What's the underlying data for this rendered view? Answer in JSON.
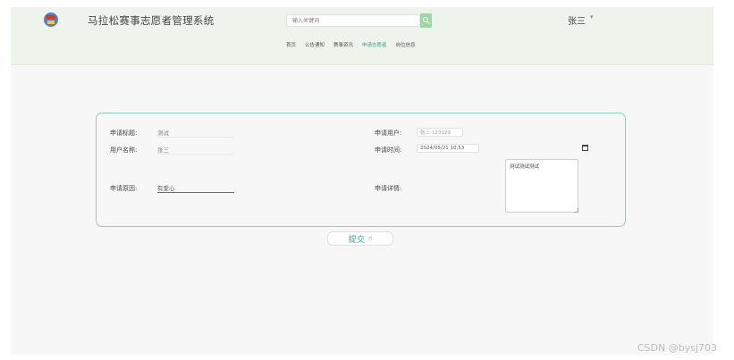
{
  "header": {
    "site_title": "马拉松赛事志愿者管理系统",
    "search_placeholder": "输入关键词",
    "user_name": "张三",
    "user_caret": "▾"
  },
  "nav": {
    "items": [
      {
        "label": "首页"
      },
      {
        "label": "公告通知"
      },
      {
        "label": "赛事资讯"
      },
      {
        "label": "申请志愿者",
        "active": true
      },
      {
        "label": "岗位信息"
      }
    ]
  },
  "form": {
    "title_label": "申请标题:",
    "title_value": "测试",
    "username_label": "用户名称:",
    "username_value": "张三",
    "reason_label": "申请原因:",
    "reason_value": "有爱心",
    "apply_user_label": "申请用户:",
    "apply_user_value": "张三-123123",
    "apply_time_label": "申请时间:",
    "apply_time_value": "2024/05/21 10:53",
    "detail_label": "申请详情:",
    "detail_value": "测试测试测试"
  },
  "submit_label": "提交",
  "watermark": "CSDN @bysj703",
  "colors": {
    "accent": "#2aa98a",
    "card_border": "#8ad1bc",
    "header_bg": "#eef4ec",
    "search_button": "#9ed6a5"
  },
  "icons": {
    "logo": "temple-logo-icon",
    "search": "search-icon",
    "calendar": "calendar-icon",
    "cursor": "hand-cursor-icon"
  }
}
